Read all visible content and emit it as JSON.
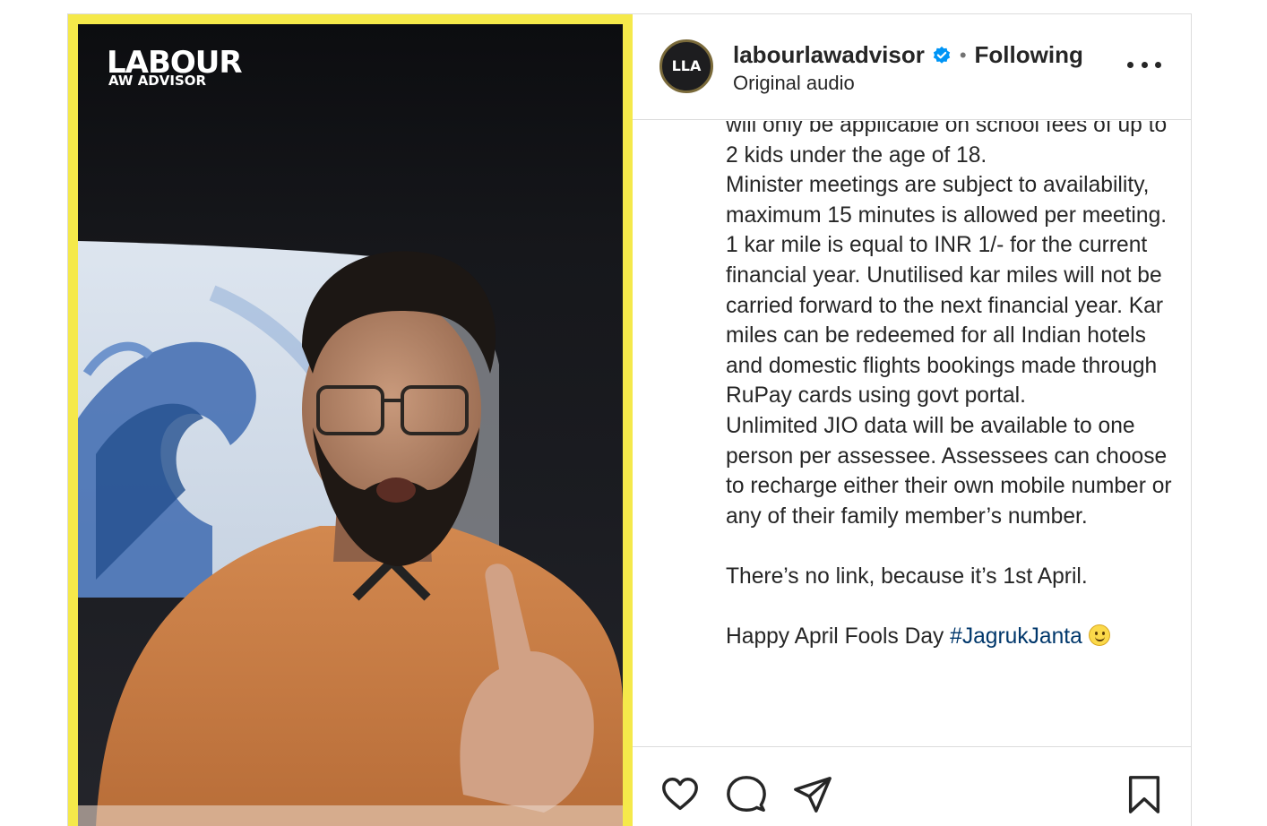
{
  "media": {
    "logo_line1": "LABOUR",
    "logo_line2": "AW ADVISOR",
    "frame_color": "#f5e94a"
  },
  "header": {
    "avatar_text": "LLA",
    "username": "labourlawadvisor",
    "verified_icon": "verified-badge-icon",
    "separator": "•",
    "follow_status": "Following",
    "subtitle": "Original audio",
    "more_icon": "more-options-icon"
  },
  "caption": {
    "body": "will only be applicable on school fees of up to 2 kids under the age of 18.\nMinister meetings are subject to availability, maximum 15 minutes is allowed per meeting.\n1 kar mile is equal to INR 1/- for the current financial year. Unutilised kar miles will not be carried forward to the next financial year. Kar miles can be redeemed for all Indian hotels and domestic flights bookings made through RuPay cards using govt portal.\nUnlimited JIO data will be available to one person per assessee. Assessees can choose to recharge either their own mobile number or any of their family member’s number.\n\nThere’s no link, because it’s 1st April.\n\n",
    "last_line": "Happy April Fools Day ",
    "hashtag": "#JagrukJanta",
    "emoji": "slightly-smiling-face-emoji"
  },
  "actions": {
    "like_icon": "heart-icon",
    "comment_icon": "comment-icon",
    "share_icon": "send-icon",
    "save_icon": "bookmark-icon"
  },
  "colors": {
    "text": "#262626",
    "link": "#00376b",
    "verified": "#0095f6",
    "border": "#dbdbdb"
  }
}
